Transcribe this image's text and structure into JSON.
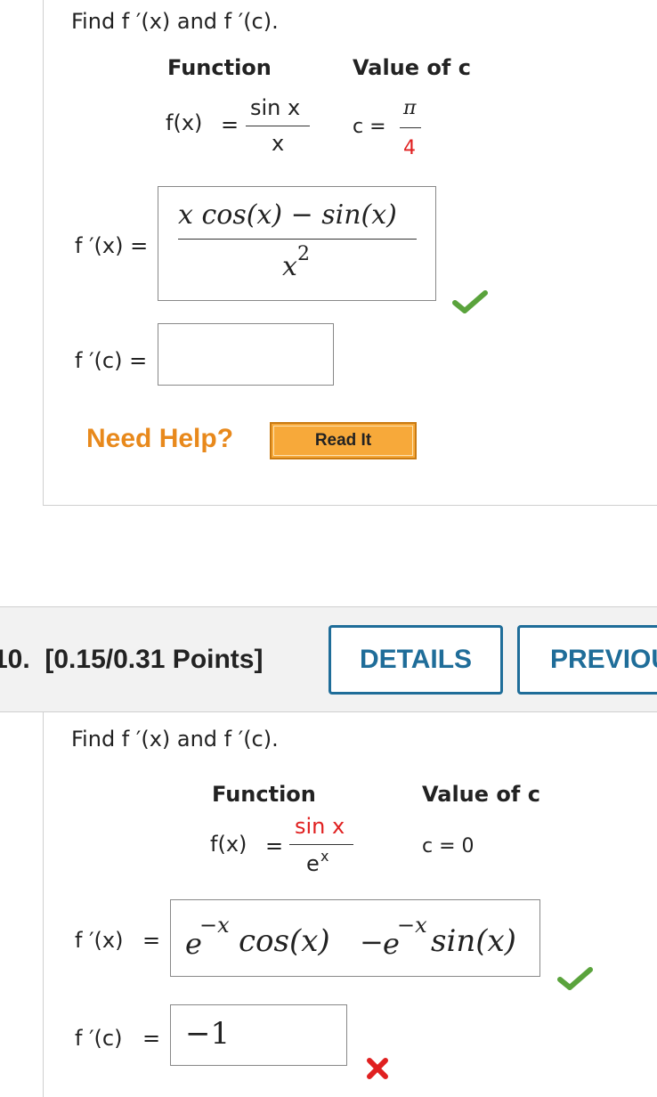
{
  "q9": {
    "prompt": "Find f ′(x) and f ′(c).",
    "function_header": "Function",
    "value_header": "Value of c",
    "fx_label": "f(x)",
    "equals": "=",
    "numerator": "sin x",
    "denominator": "x",
    "c_label": "c =",
    "c_num": "π",
    "c_den": "4",
    "fprime_x_label": "f ′(x) =",
    "fprime_x_answer_num": "x cos(x) − sin(x)",
    "fprime_x_answer_den": "x",
    "fprime_x_answer_den_exp": "2",
    "fprime_c_label": "f ′(c) =",
    "fprime_c_answer": "",
    "need_help": "Need Help?",
    "read_it": "Read It"
  },
  "q10": {
    "header_title": "10.  [0.15/0.31 Points]",
    "details_button": "DETAILS",
    "previous_button": "PREVIOU",
    "prompt": "Find f ′(x) and f ′(c).",
    "function_header": "Function",
    "value_header": "Value of c",
    "fx_label": "f(x)",
    "equals": "=",
    "numerator": "sin x",
    "denominator": "e",
    "denominator_exp": "x",
    "c_value": "c = 0",
    "fprime_x_label": "f ′(x)",
    "fprime_x_eq": "=",
    "fprime_x_answer": {
      "t1_base": "e",
      "t1_exp": "−x",
      "t1_func": "cos(x)",
      "minus": "−",
      "t2_base": "e",
      "t2_exp": "−x",
      "t2_func": "sin(x)"
    },
    "fprime_c_label": "f ′(c)",
    "fprime_c_eq": "=",
    "fprime_c_answer": "−1"
  },
  "colors": {
    "accent_blue": "#1f6d99",
    "help_orange": "#e8891c",
    "readit_orange": "#f7a93a",
    "check_green": "#5aa33c",
    "cross_red": "#e02020"
  }
}
